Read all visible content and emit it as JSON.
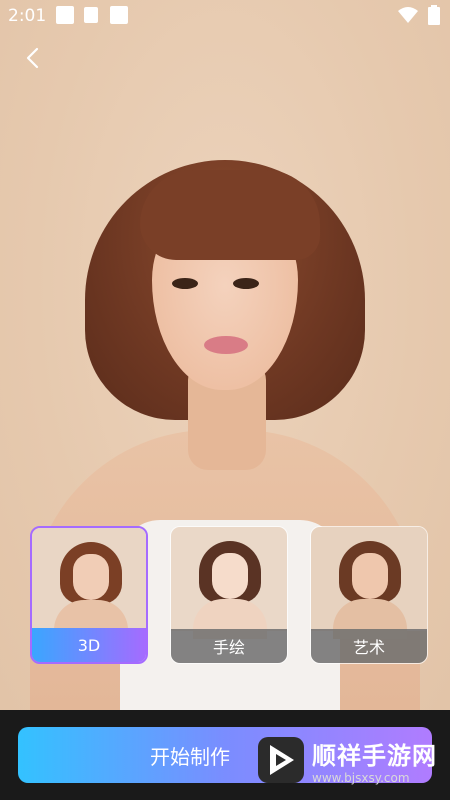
{
  "status_bar": {
    "time": "2:01",
    "icons": [
      "notification-square-icon",
      "a-icon",
      "notification-square-icon",
      "wifi-icon",
      "battery-icon"
    ]
  },
  "nav": {
    "back_icon": "chevron-left-icon"
  },
  "styles": [
    {
      "label": "3D",
      "selected": true
    },
    {
      "label": "手绘",
      "selected": false
    },
    {
      "label": "艺术",
      "selected": false
    }
  ],
  "actions": {
    "start_label": "开始制作"
  },
  "watermark": {
    "title": "顺祥手游网",
    "url": "www.bjsxsy.com"
  },
  "colors": {
    "background": "#e8cdb3",
    "accent_start": "#33c2ff",
    "accent_end": "#b07cff",
    "selected_border": "#a56bff",
    "bottom_bar": "#1a1a1a"
  }
}
